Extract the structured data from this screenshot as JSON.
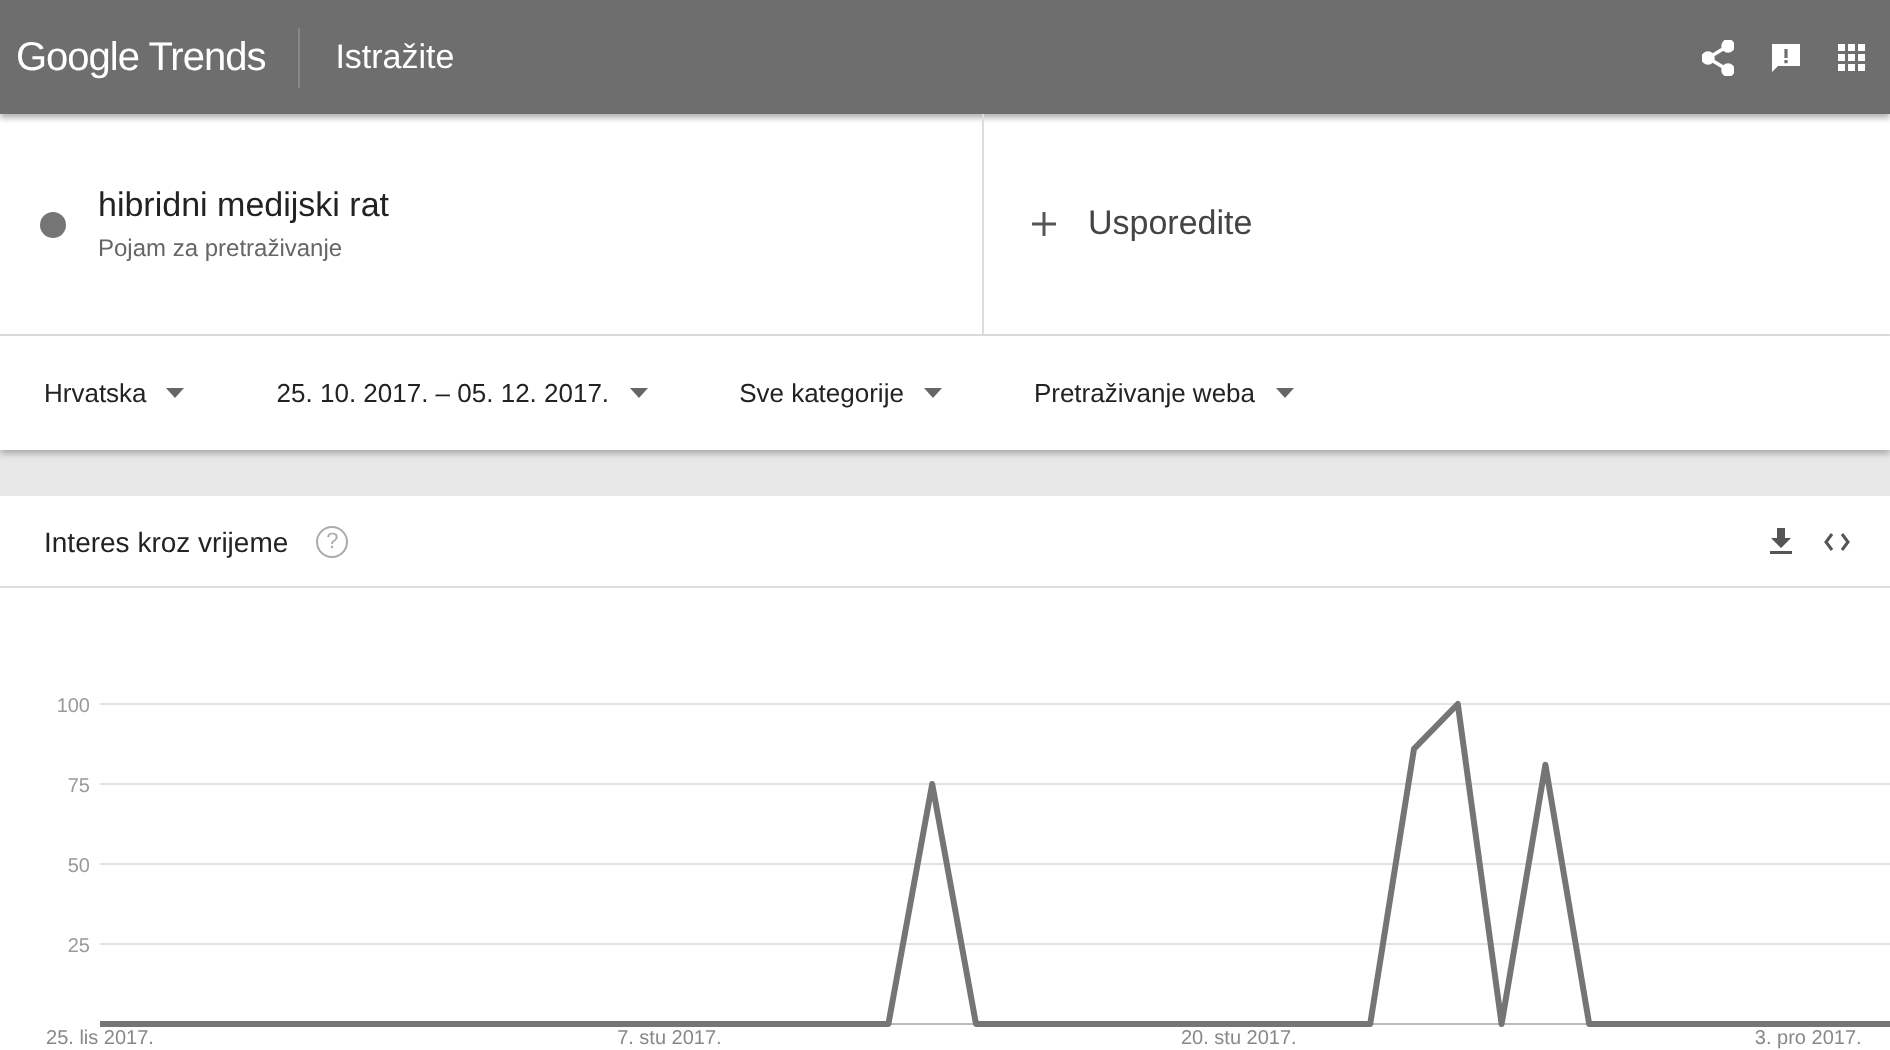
{
  "header": {
    "logo": "Google Trends",
    "title": "Istražite"
  },
  "terms": [
    {
      "name": "hibridni medijski rat",
      "sublabel": "Pojam za pretraživanje",
      "color": "#757575"
    }
  ],
  "compare": {
    "label": "Usporedite"
  },
  "filters": [
    {
      "label": "Hrvatska"
    },
    {
      "label": "25. 10. 2017. – 05. 12. 2017."
    },
    {
      "label": "Sve kategorije"
    },
    {
      "label": "Pretraživanje weba"
    }
  ],
  "interest": {
    "title": "Interes kroz vrijeme",
    "help": "?",
    "chart_data": {
      "type": "line",
      "categories": [
        "25. lis 2017.",
        null,
        null,
        null,
        null,
        null,
        null,
        null,
        null,
        null,
        null,
        null,
        null,
        "7. stu 2017.",
        null,
        null,
        null,
        null,
        null,
        null,
        null,
        null,
        null,
        null,
        null,
        null,
        "20. stu 2017.",
        null,
        null,
        null,
        null,
        null,
        null,
        null,
        null,
        null,
        null,
        null,
        null,
        "3. pro 2017.",
        null,
        null
      ],
      "series": [
        {
          "color": "#757575",
          "values": [
            0,
            0,
            0,
            0,
            0,
            0,
            0,
            0,
            0,
            0,
            0,
            0,
            0,
            0,
            0,
            0,
            0,
            0,
            0,
            75,
            0,
            0,
            0,
            0,
            0,
            0,
            0,
            0,
            0,
            0,
            86,
            100,
            0,
            81,
            0,
            0,
            0,
            0,
            0,
            0,
            0,
            0
          ]
        }
      ],
      "ylim": [
        0,
        100
      ],
      "yticks": [
        25,
        50,
        75,
        100
      ],
      "grid": true
    }
  }
}
